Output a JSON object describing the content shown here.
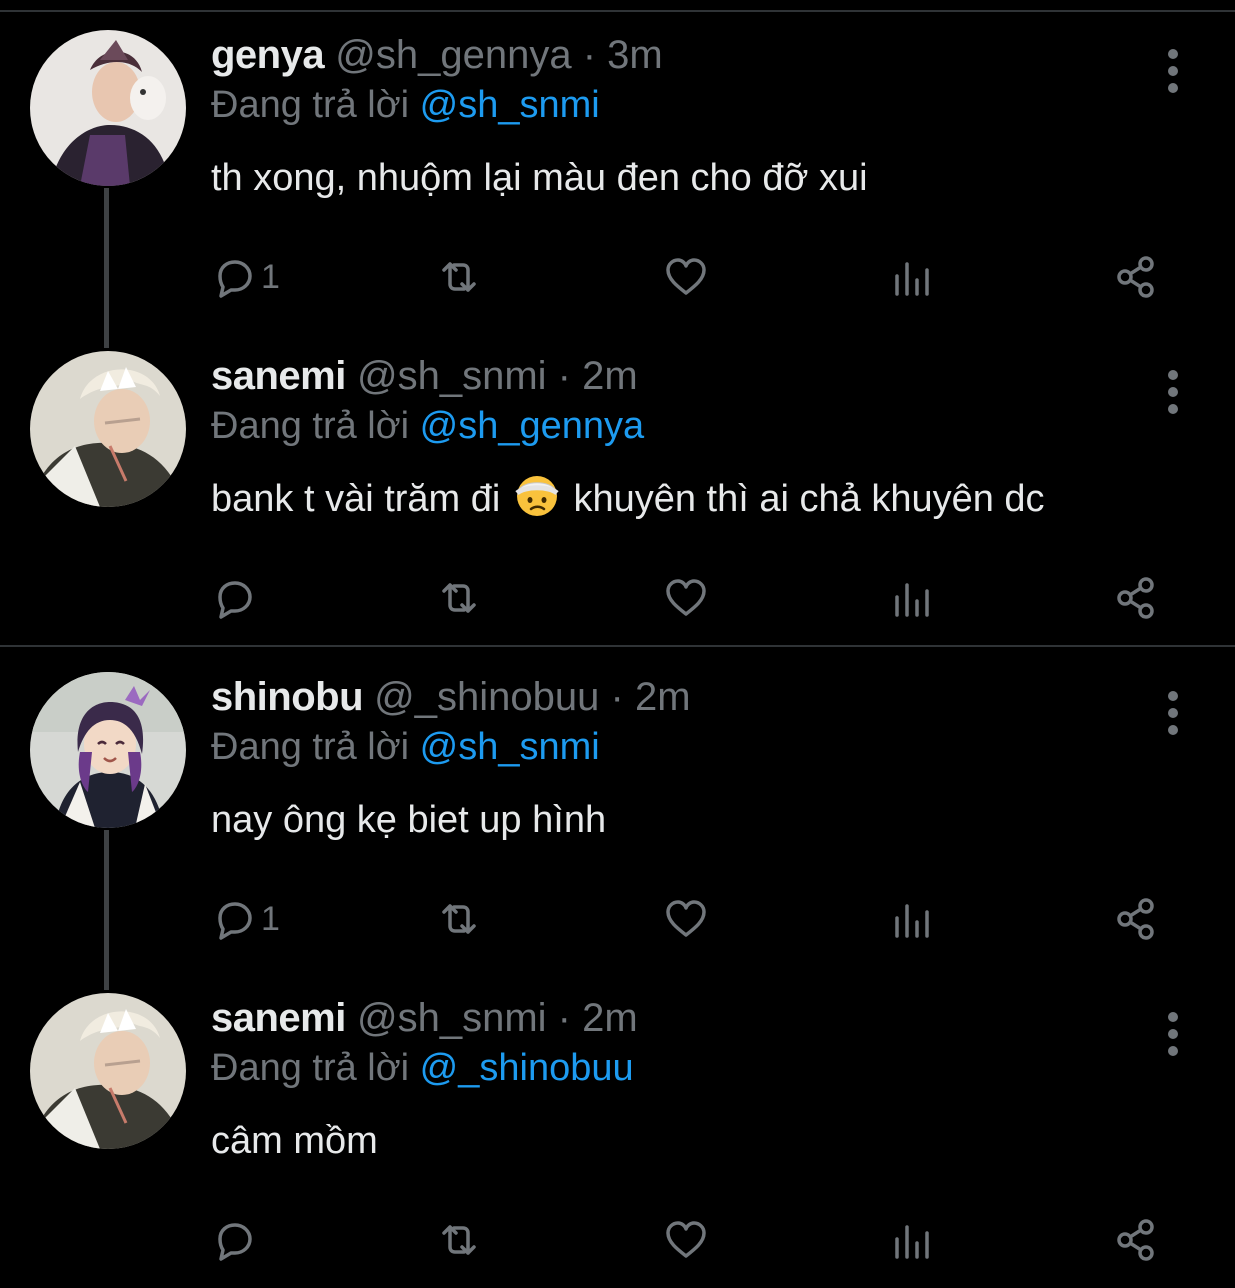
{
  "colors": {
    "background": "#000000",
    "text": "#e7e9ea",
    "muted": "#71767b",
    "mention": "#1d9bf0",
    "divider": "#2f3336"
  },
  "tweets": [
    {
      "display_name": "genya",
      "handle": "@sh_gennya",
      "separator": "·",
      "time": "3m",
      "reply_prefix": "Đang trả lời",
      "reply_to": "@sh_snmi",
      "text_before": "th xong, nhuộm lại màu đen cho đỡ xui",
      "emoji": "",
      "text_after": "",
      "reply_count": "1",
      "avatar_icon": "avatar-genya"
    },
    {
      "display_name": "sanemi",
      "handle": "@sh_snmi",
      "separator": "·",
      "time": "2m",
      "reply_prefix": "Đang trả lời",
      "reply_to": "@sh_gennya",
      "text_before": "bank t vài trăm đi",
      "emoji": "face-with-head-bandage",
      "text_after": "khuyên thì ai chả khuyên dc",
      "reply_count": "",
      "avatar_icon": "avatar-sanemi"
    },
    {
      "display_name": "shinobu",
      "handle": "@_shinobuu",
      "separator": "·",
      "time": "2m",
      "reply_prefix": "Đang trả lời",
      "reply_to": "@sh_snmi",
      "text_before": "nay ông kẹ biet up hình",
      "emoji": "",
      "text_after": "",
      "reply_count": "1",
      "avatar_icon": "avatar-shinobu"
    },
    {
      "display_name": "sanemi",
      "handle": "@sh_snmi",
      "separator": "·",
      "time": "2m",
      "reply_prefix": "Đang trả lời",
      "reply_to": "@_shinobuu",
      "text_before": "câm mồm",
      "emoji": "",
      "text_after": "",
      "reply_count": "",
      "avatar_icon": "avatar-sanemi"
    }
  ],
  "actions": [
    "reply-icon",
    "retweet-icon",
    "like-icon",
    "analytics-icon",
    "share-icon"
  ]
}
